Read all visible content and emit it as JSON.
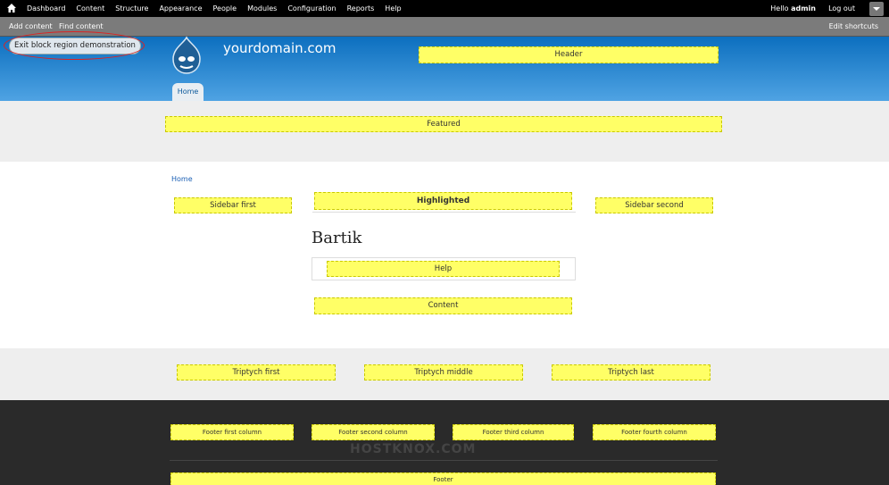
{
  "toolbar": {
    "menu": [
      "Dashboard",
      "Content",
      "Structure",
      "Appearance",
      "People",
      "Modules",
      "Configuration",
      "Reports",
      "Help"
    ],
    "hello": "Hello",
    "username": "admin",
    "logout": "Log out"
  },
  "shortcuts": {
    "items": [
      "Add content",
      "Find content"
    ],
    "edit": "Edit shortcuts"
  },
  "header": {
    "exit_button": "Exit block region demonstration",
    "site_name": "yourdomain.com",
    "tab_home": "Home"
  },
  "regions": {
    "header": "Header",
    "featured": "Featured",
    "sidebar_first": "Sidebar first",
    "highlighted": "Highlighted",
    "sidebar_second": "Sidebar second",
    "help": "Help",
    "content": "Content",
    "triptych_first": "Triptych first",
    "triptych_middle": "Triptych middle",
    "triptych_last": "Triptych last",
    "footer_first": "Footer first column",
    "footer_second": "Footer second column",
    "footer_third": "Footer third column",
    "footer_fourth": "Footer fourth column",
    "footer": "Footer"
  },
  "main": {
    "breadcrumb": "Home",
    "title": "Bartik"
  },
  "watermark": "HOSTKNOX.COM",
  "colors": {
    "region_fill": "#ffff66",
    "header_gradient_top": "#0c6fbf",
    "header_gradient_bottom": "#4fa3e3"
  }
}
